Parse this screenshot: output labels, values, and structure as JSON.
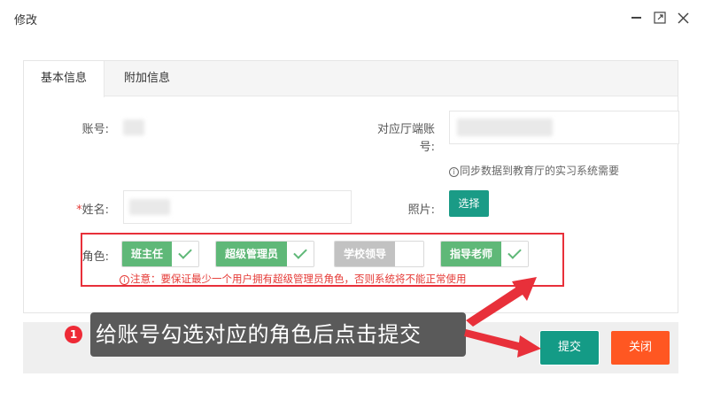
{
  "dialog": {
    "title": "修改"
  },
  "tabs": [
    {
      "label": "基本信息",
      "active": true
    },
    {
      "label": "附加信息",
      "active": false
    }
  ],
  "form": {
    "account_label": "账号:",
    "hall_account_label_1": "对应厅端账",
    "hall_account_label_2": "号:",
    "sync_hint": "同步数据到教育厅的实习系统需要",
    "name_required_mark": "*",
    "name_label": "姓名:",
    "photo_label": "照片:",
    "select_button": "选择",
    "role_label": "角色:",
    "roles": [
      {
        "label": "班主任",
        "checked": true
      },
      {
        "label": "超级管理员",
        "checked": true
      },
      {
        "label": "学校领导",
        "checked": false
      },
      {
        "label": "指导老师",
        "checked": true
      }
    ],
    "role_warning": "注意：要保证最少一个用户拥有超级管理员角色，否则系统将不能正常使用"
  },
  "footer": {
    "submit_label": "提交",
    "close_label": "关闭"
  },
  "annotation": {
    "step_number": "1",
    "text": "给账号勾选对应的角色后点击提交"
  },
  "colors": {
    "primary_green": "#149b86",
    "check_green": "#5fb878",
    "danger_orange": "#ff5722",
    "highlight_red": "#e8303a",
    "disabled_gray": "#c2c2c2"
  },
  "icons": [
    "minimize-icon",
    "maximize-icon",
    "close-icon",
    "info-icon",
    "check-icon",
    "arrow-icon"
  ]
}
